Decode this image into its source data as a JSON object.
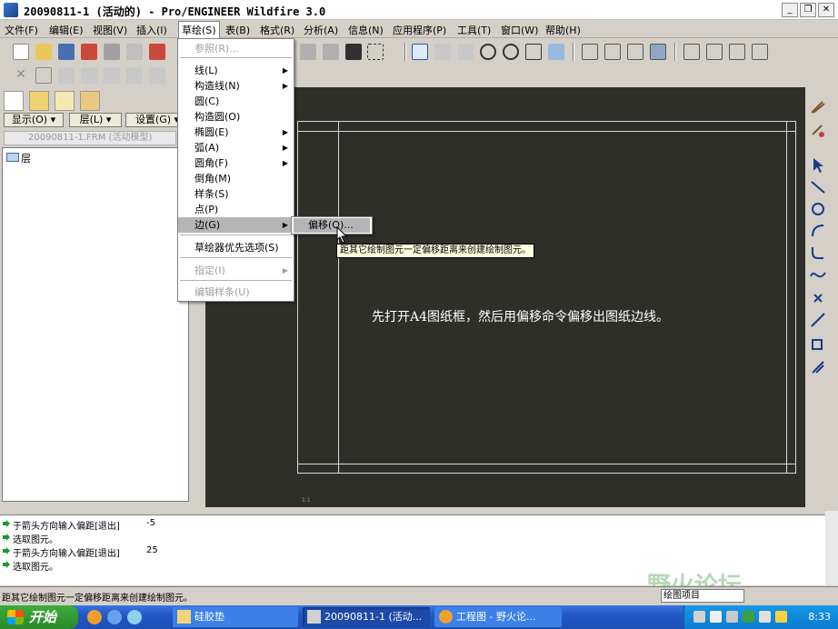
{
  "window": {
    "title": "20090811-1 (活动的) - Pro/ENGINEER Wildfire 3.0",
    "minimize": "_",
    "restore": "❐",
    "close": "✕"
  },
  "menubar": [
    {
      "label": "文件(F)"
    },
    {
      "label": "编辑(E)"
    },
    {
      "label": "视图(V)"
    },
    {
      "label": "插入(I)"
    },
    {
      "label": "草绘(S)"
    },
    {
      "label": "表(B)"
    },
    {
      "label": "格式(R)"
    },
    {
      "label": "分析(A)"
    },
    {
      "label": "信息(N)"
    },
    {
      "label": "应用程序(P)"
    },
    {
      "label": "工具(T)"
    },
    {
      "label": "窗口(W)"
    },
    {
      "label": "帮助(H)"
    }
  ],
  "sketch_menu": {
    "items": [
      {
        "label": "参照(R)...",
        "disabled": true
      },
      {
        "label": "线(L)",
        "submenu": true
      },
      {
        "label": "构造线(N)",
        "submenu": true
      },
      {
        "label": "圆(C)"
      },
      {
        "label": "构造圆(O)"
      },
      {
        "label": "椭圆(E)",
        "submenu": true
      },
      {
        "label": "弧(A)",
        "submenu": true
      },
      {
        "label": "圆角(F)",
        "submenu": true
      },
      {
        "label": "倒角(M)"
      },
      {
        "label": "样条(S)"
      },
      {
        "label": "点(P)"
      },
      {
        "label": "边(G)",
        "submenu": true,
        "highlighted": true
      },
      {
        "label": "草绘器优先选项(S)"
      },
      {
        "label": "指定(I)",
        "disabled": true,
        "submenu": true
      },
      {
        "label": "编辑样条(U)",
        "disabled": true
      }
    ],
    "submenu_item": "偏移(O)...",
    "tooltip": "距其它绘制图元一定偏移距离来创建绘制图元。"
  },
  "left_panel": {
    "show_button": "显示(O) ▾",
    "layer_button": "层(L) ▾",
    "settings_button": "设置(G) ▾",
    "model_path": "20090811-1.FRM (活动模型)",
    "tree_item": "层"
  },
  "graphics": {
    "annotation": "先打开A4图纸框，然后用偏移命令偏移出图纸边线。",
    "coords": "1:1"
  },
  "messages": [
    {
      "text": "于箭头方向输入偏距[退出]",
      "value": "-5"
    },
    {
      "text": "选取图元。",
      "value": ""
    },
    {
      "text": "于箭头方向输入偏距[退出]",
      "value": "25"
    },
    {
      "text": "选取图元。",
      "value": ""
    }
  ],
  "status": {
    "text": "距其它绘制图元一定偏移距离来创建绘制图元。",
    "filter": "绘图项目"
  },
  "watermark": "野火论坛",
  "taskbar": {
    "start": "开始",
    "tasks": [
      {
        "label": "硅胶垫"
      },
      {
        "label": "20090811-1 (活动..."
      },
      {
        "label": "工程图 - 野火论..."
      }
    ],
    "clock": "8:33"
  },
  "colors": {
    "graphics_bg": "#2f2f2a",
    "menu_highlight": "#b5b5b5",
    "tooltip_bg": "#ffffe1",
    "taskbar": "#2357c6",
    "start_green": "#2a8a2a"
  }
}
